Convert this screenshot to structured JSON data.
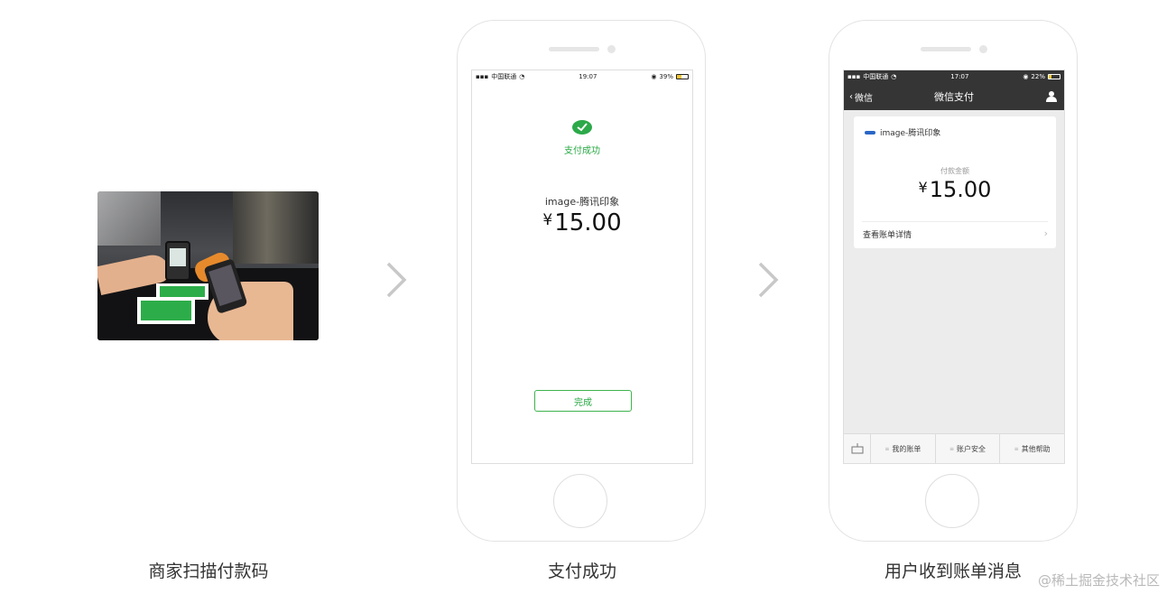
{
  "captions": {
    "step1": "商家扫描付款码",
    "step2": "支付成功",
    "step3": "用户收到账单消息"
  },
  "screen1": {
    "status": {
      "carrier": "中国联通",
      "time": "19:07",
      "battery": "39%"
    },
    "success_text": "支付成功",
    "merchant": "image-腾讯印象",
    "currency": "¥",
    "amount": "15.00",
    "done_button": "完成"
  },
  "screen2": {
    "status": {
      "carrier": "中国联通",
      "time": "17:07",
      "battery": "22%"
    },
    "nav": {
      "back_label": "微信",
      "title": "微信支付"
    },
    "card": {
      "merchant": "image-腾讯印象",
      "amount_label": "付款金额",
      "currency": "¥",
      "amount": "15.00",
      "detail_link": "查看账单详情"
    },
    "bottom_tabs": [
      "我的账单",
      "账户安全",
      "其他帮助"
    ]
  },
  "watermark": "@稀土掘金技术社区",
  "colors": {
    "wechat_green": "#26a842",
    "nav_dark": "#353535"
  }
}
